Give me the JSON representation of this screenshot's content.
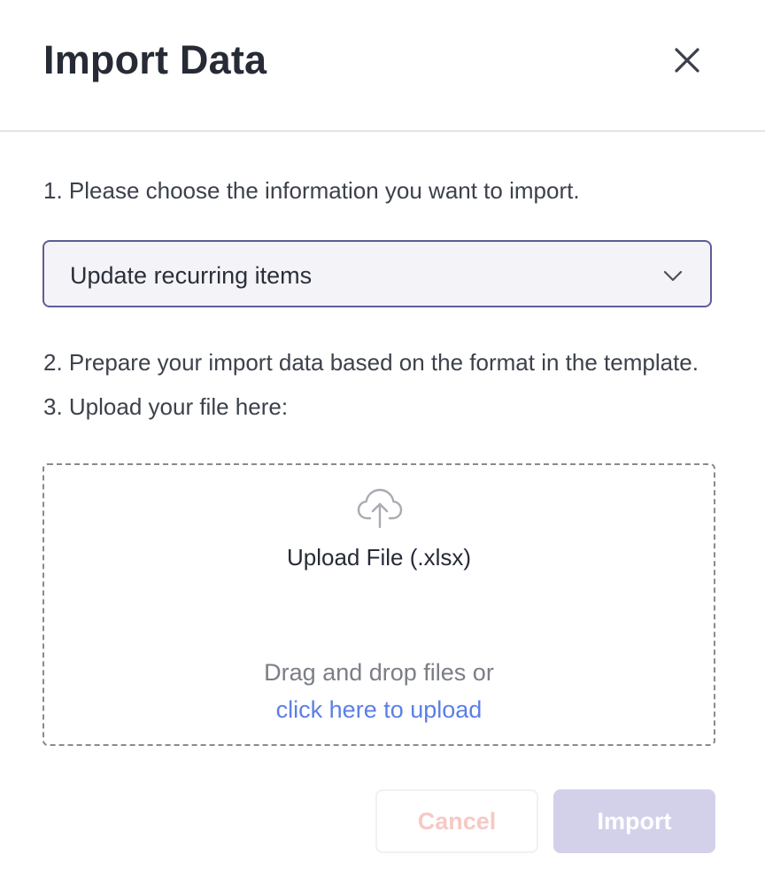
{
  "dialog": {
    "title": "Import Data",
    "close_icon": "close-icon"
  },
  "steps": {
    "step1": "1. Please choose the information you want to import.",
    "step2": "2. Prepare your import data based on the format in the template.",
    "step3": "3. Upload your file here:"
  },
  "select": {
    "value": "Update recurring items",
    "icon": "chevron-down-icon",
    "border_color": "#5d5d98"
  },
  "dropzone": {
    "icon": "cloud-upload-icon",
    "title": "Upload File (.xlsx)",
    "drag_text": "Drag and drop files or",
    "link_text": "click here to upload",
    "link_color": "#5b7fe6"
  },
  "footer": {
    "cancel_label": "Cancel",
    "import_label": "Import",
    "cancel_text_color": "#f6c9c6",
    "import_bg_color": "#d3d1ea"
  }
}
